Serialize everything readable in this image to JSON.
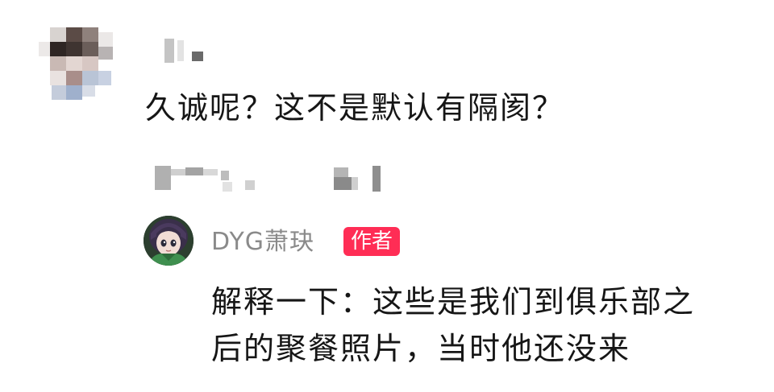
{
  "comment": {
    "text": "久诚呢？这不是默认有隔阂？"
  },
  "author_reply": {
    "author_name": "DYG萧玦",
    "badge_label": "作者",
    "text_lines": [
      "解释一下：这些是我们到俱乐部之",
      "后的聚餐照片，当时他还没来"
    ]
  },
  "colors": {
    "badge": "#ff2d55",
    "author_name": "#8a8a8a",
    "text": "#161616",
    "background": "#ffffff"
  },
  "icons": {
    "commenter_avatar": "pixelated-avatar",
    "author_avatar": "anime-character-avatar"
  }
}
